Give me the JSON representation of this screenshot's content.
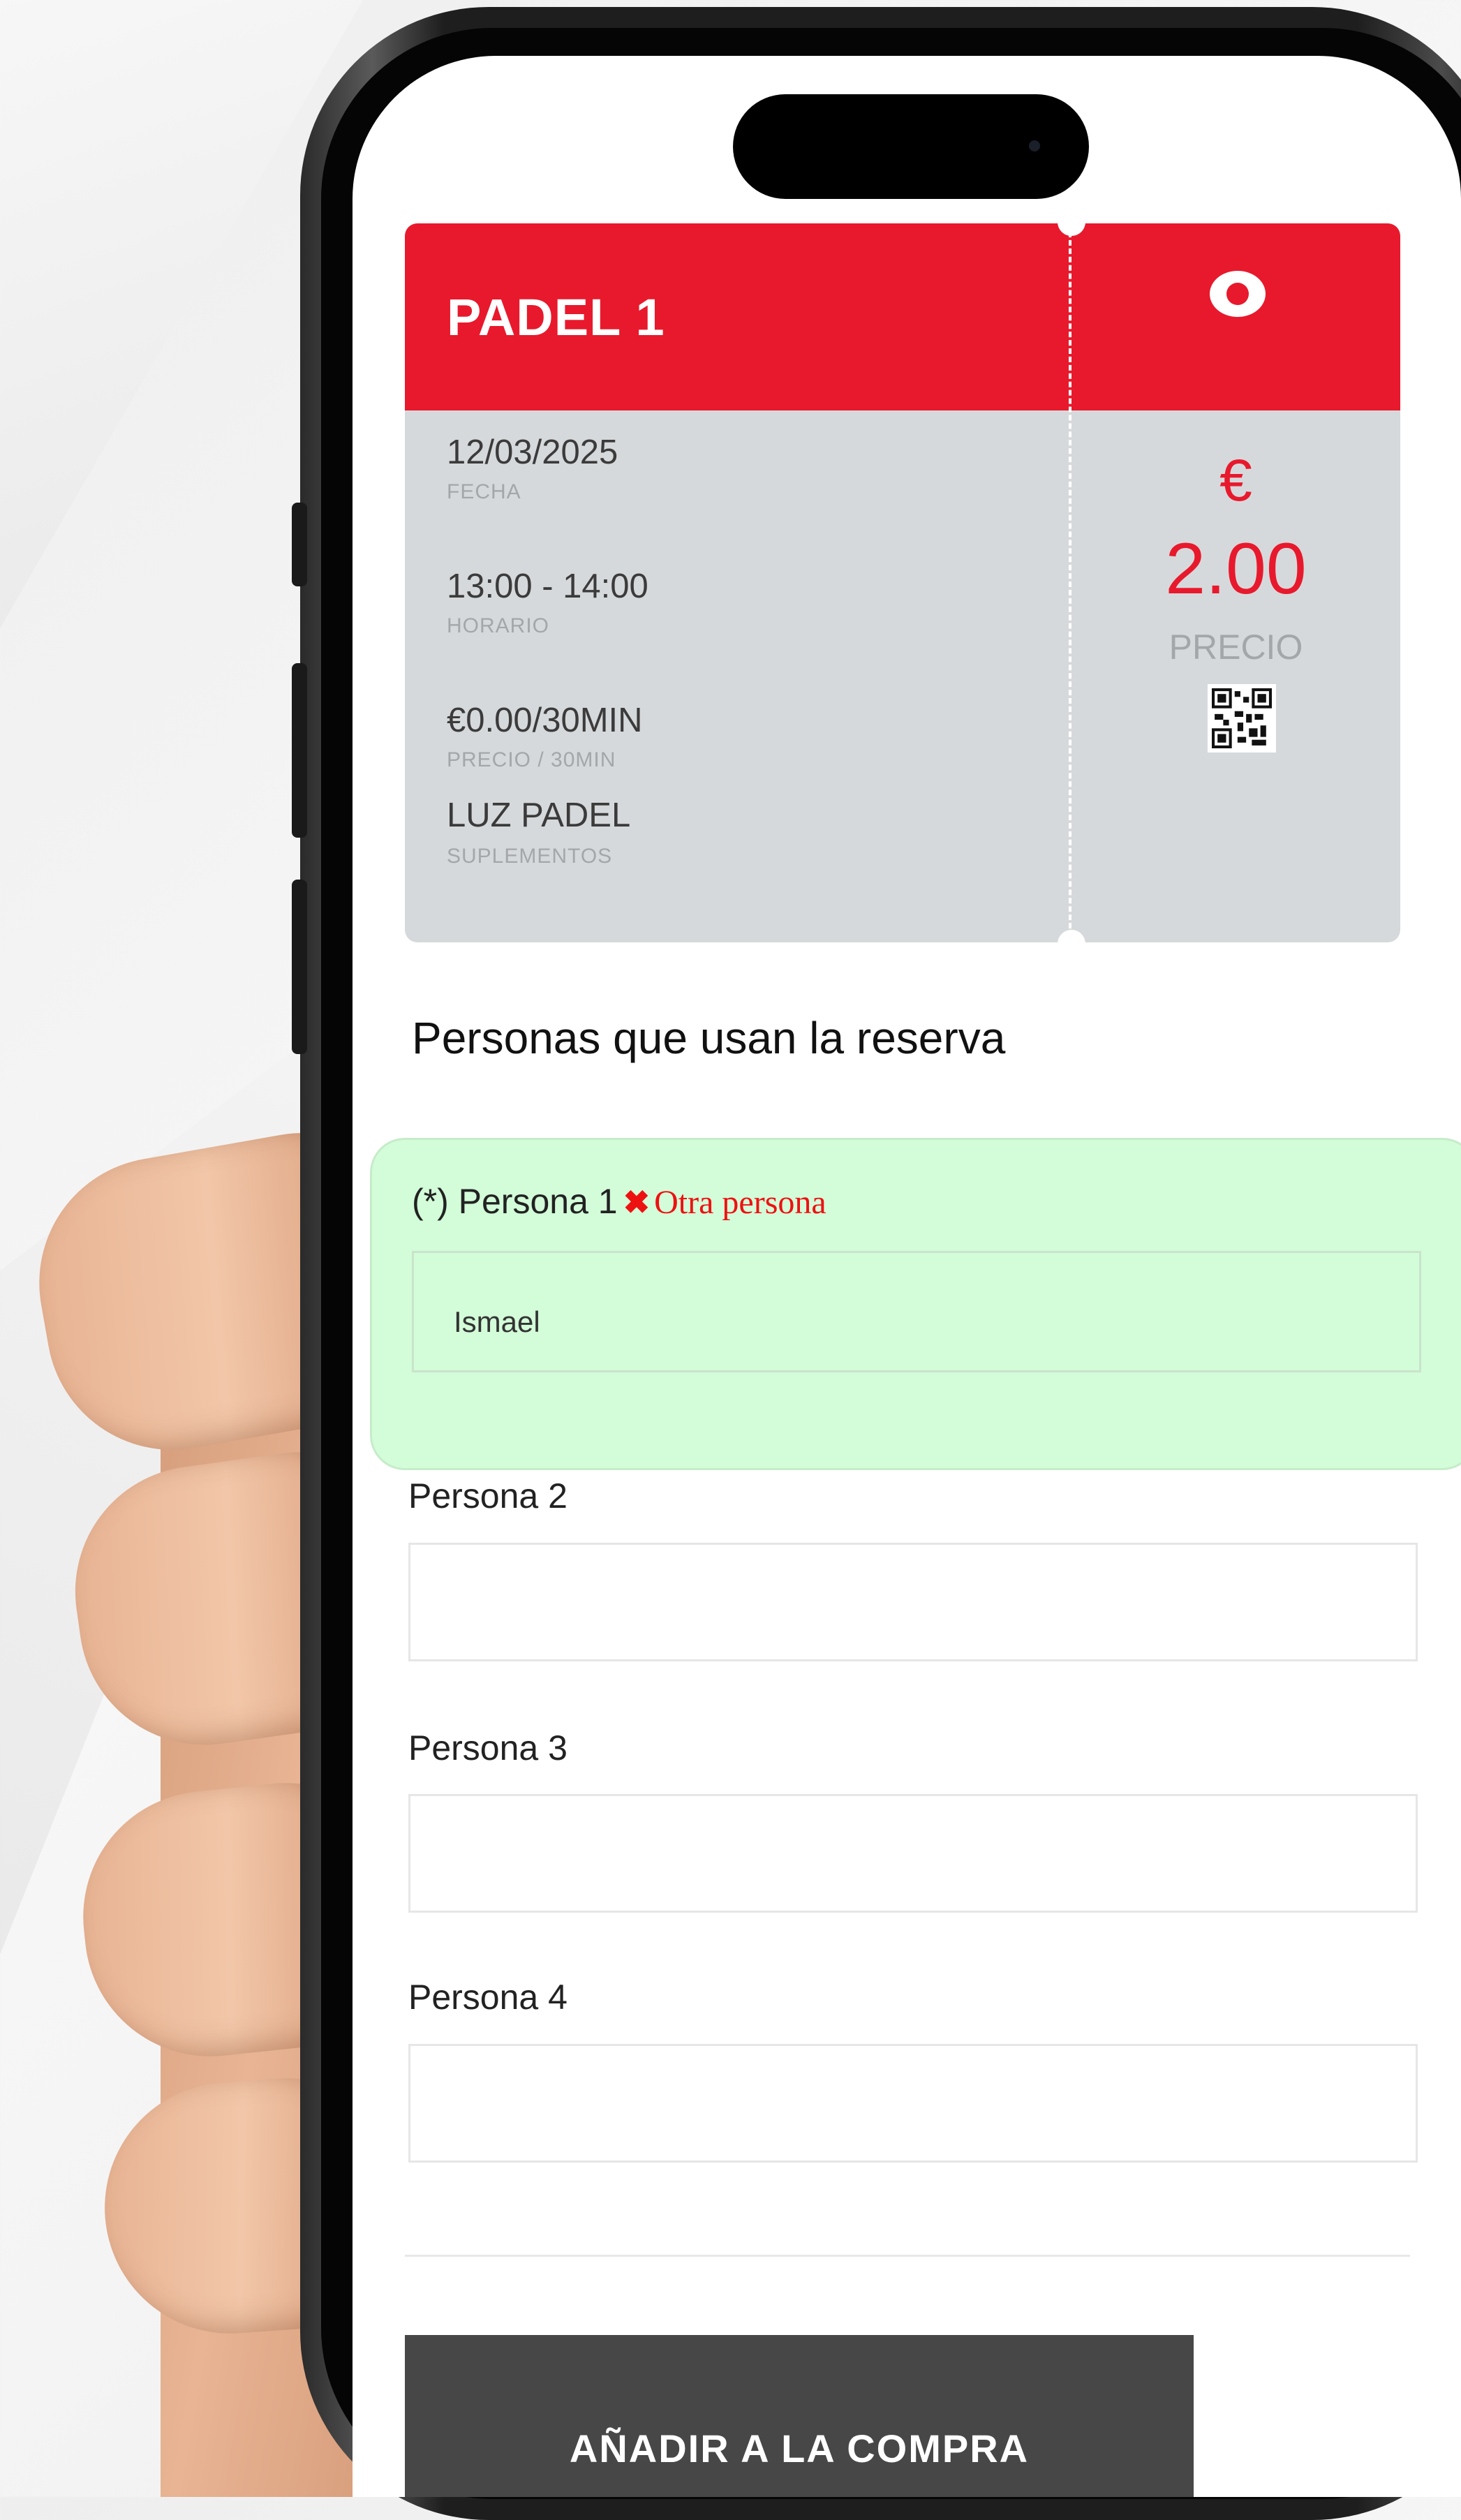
{
  "ticket": {
    "title": "PADEL 1",
    "fields": [
      {
        "value": "12/03/2025",
        "label": "FECHA"
      },
      {
        "value": "13:00 - 14:00",
        "label": "HORARIO"
      },
      {
        "value": "€0.00/30MIN",
        "label": "PRECIO / 30MIN"
      },
      {
        "value": "LUZ PADEL",
        "label": "SUPLEMENTOS"
      }
    ],
    "price_symbol": "€",
    "price_value": "2.00",
    "price_label": "PRECIO",
    "accent_color": "#e8192c"
  },
  "persons": {
    "section_title": "Personas que usan la reserva",
    "person1": {
      "label": "(*) Persona 1",
      "remove_link": "Otra persona",
      "value": "Ismael"
    },
    "person2": {
      "label": "Persona 2",
      "value": ""
    },
    "person3": {
      "label": "Persona 3",
      "value": ""
    },
    "person4": {
      "label": "Persona 4",
      "value": ""
    }
  },
  "actions": {
    "add_label": "AÑADIR A LA COMPRA"
  },
  "icons": [
    "eye-icon",
    "qr-code-icon",
    "close-icon"
  ]
}
